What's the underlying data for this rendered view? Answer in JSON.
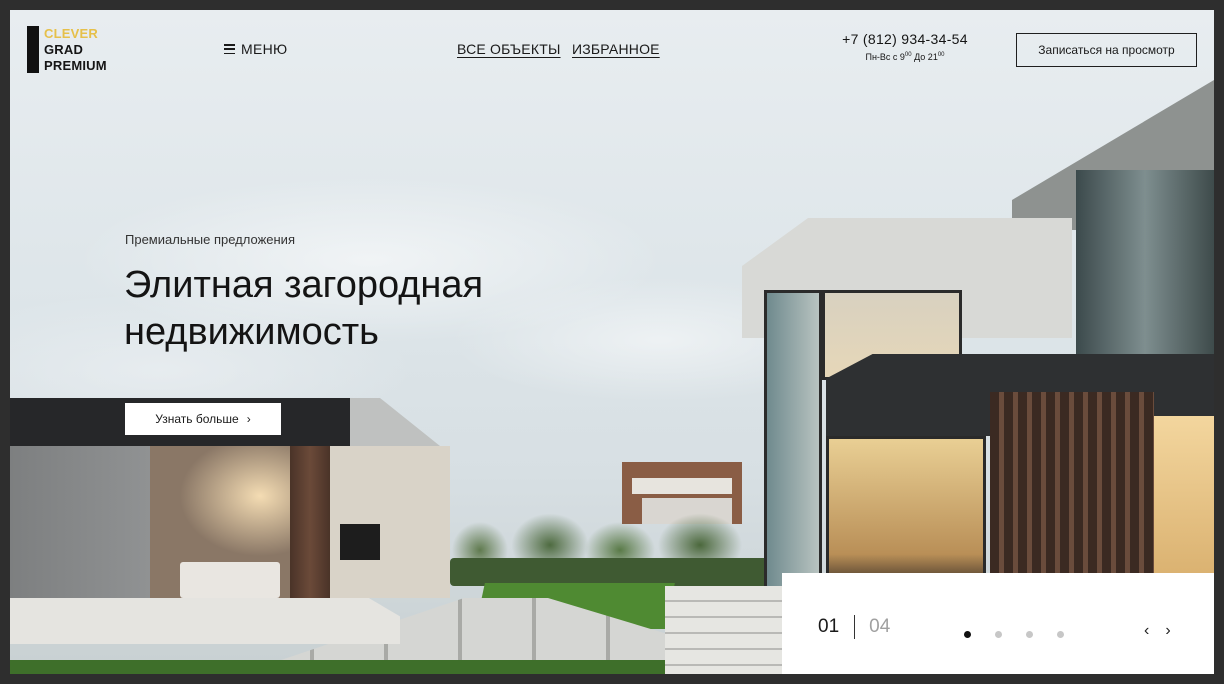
{
  "header": {
    "logo": {
      "line1": "CLEVER",
      "line2": "GRAD",
      "line3": "PREMIUM"
    },
    "menu_label": "МЕНЮ",
    "nav": [
      {
        "label": "ВСЕ ОБЪЕКТЫ"
      },
      {
        "label": "ИЗБРАННОЕ"
      }
    ],
    "phone": "+7 (812) 934-34-54",
    "hours": {
      "prefix": "Пн-Вс с 9",
      "sup1": "00",
      "middle": "  До 21",
      "sup2": "00"
    },
    "cta_label": "Записаться на просмотр"
  },
  "hero": {
    "eyebrow": "Премиальные предложения",
    "title_line1": "Элитная загородная",
    "title_line2": "недвижимость",
    "more_label": "Узнать больше",
    "more_icon": "chevron-right-icon"
  },
  "slider": {
    "current": "01",
    "total": "04",
    "dots_count": 4,
    "active_dot": 1,
    "prev_icon": "‹",
    "next_icon": "›"
  },
  "colors": {
    "logo_accent": "#e6c04a",
    "text_dark": "#141414",
    "counter_muted": "#a0a0a0"
  }
}
